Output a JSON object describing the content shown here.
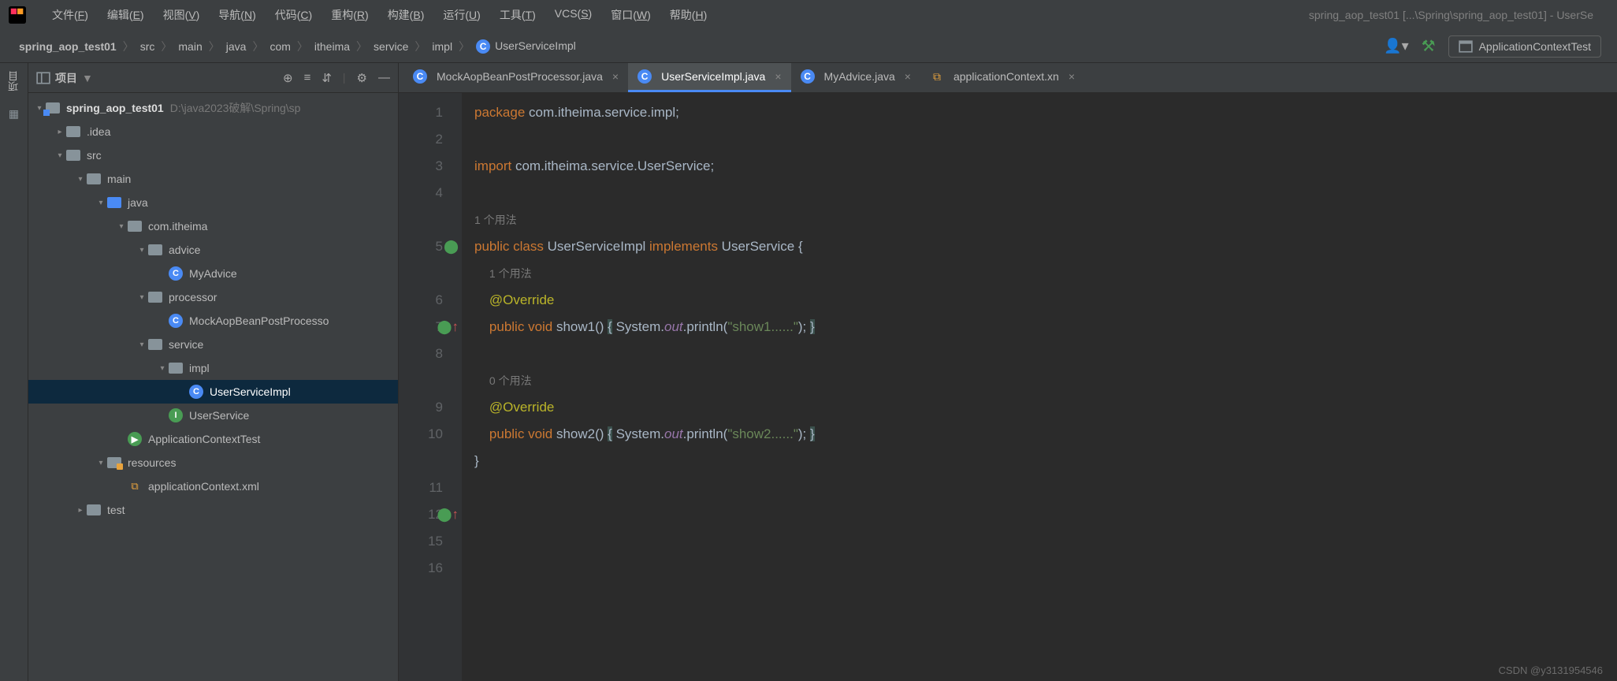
{
  "menubar": {
    "items": [
      {
        "text": "文件",
        "key": "F"
      },
      {
        "text": "编辑",
        "key": "E"
      },
      {
        "text": "视图",
        "key": "V"
      },
      {
        "text": "导航",
        "key": "N"
      },
      {
        "text": "代码",
        "key": "C"
      },
      {
        "text": "重构",
        "key": "R"
      },
      {
        "text": "构建",
        "key": "B"
      },
      {
        "text": "运行",
        "key": "U"
      },
      {
        "text": "工具",
        "key": "T"
      },
      {
        "text": "VCS",
        "key": "S"
      },
      {
        "text": "窗口",
        "key": "W"
      },
      {
        "text": "帮助",
        "key": "H"
      }
    ],
    "title_right": "spring_aop_test01 [...\\Spring\\spring_aop_test01] - UserSe"
  },
  "breadcrumb": {
    "parts": [
      "spring_aop_test01",
      "src",
      "main",
      "java",
      "com",
      "itheima",
      "service",
      "impl",
      "UserServiceImpl"
    ]
  },
  "run_config": "ApplicationContextTest",
  "project": {
    "header": "项目",
    "root": {
      "name": "spring_aop_test01",
      "path": "D:\\java2023破解\\Spring\\sp"
    },
    "tree_lines": [
      {
        "depth": 1,
        "arrow": "▸",
        "icon": "folder",
        "label": ".idea"
      },
      {
        "depth": 1,
        "arrow": "▾",
        "icon": "folder",
        "label": "src"
      },
      {
        "depth": 2,
        "arrow": "▾",
        "icon": "folder",
        "label": "main"
      },
      {
        "depth": 3,
        "arrow": "▾",
        "icon": "folder-blue",
        "label": "java"
      },
      {
        "depth": 4,
        "arrow": "▾",
        "icon": "folder",
        "label": "com.itheima"
      },
      {
        "depth": 5,
        "arrow": "▾",
        "icon": "folder",
        "label": "advice"
      },
      {
        "depth": 6,
        "arrow": "",
        "icon": "class",
        "label": "MyAdvice"
      },
      {
        "depth": 5,
        "arrow": "▾",
        "icon": "folder",
        "label": "processor"
      },
      {
        "depth": 6,
        "arrow": "",
        "icon": "class",
        "label": "MockAopBeanPostProcesso"
      },
      {
        "depth": 5,
        "arrow": "▾",
        "icon": "folder",
        "label": "service"
      },
      {
        "depth": 6,
        "arrow": "▾",
        "icon": "folder",
        "label": "impl"
      },
      {
        "depth": 7,
        "arrow": "",
        "icon": "class",
        "label": "UserServiceImpl",
        "selected": true
      },
      {
        "depth": 6,
        "arrow": "",
        "icon": "interface",
        "label": "UserService"
      },
      {
        "depth": 4,
        "arrow": "",
        "icon": "class-play",
        "label": "ApplicationContextTest"
      },
      {
        "depth": 3,
        "arrow": "▾",
        "icon": "folder-res",
        "label": "resources"
      },
      {
        "depth": 4,
        "arrow": "",
        "icon": "xml",
        "label": "applicationContext.xml"
      },
      {
        "depth": 2,
        "arrow": "▸",
        "icon": "folder",
        "label": "test"
      }
    ]
  },
  "left_tab": "项目",
  "editor": {
    "tabs": [
      {
        "icon": "class",
        "label": "MockAopBeanPostProcessor.java"
      },
      {
        "icon": "class",
        "label": "UserServiceImpl.java",
        "active": true
      },
      {
        "icon": "class",
        "label": "MyAdvice.java"
      },
      {
        "icon": "xml",
        "label": "applicationContext.xn"
      }
    ],
    "gutter": [
      "1",
      "2",
      "3",
      "4",
      "",
      "5",
      "",
      "6",
      "7",
      "8",
      "",
      "9",
      "10",
      "",
      "11",
      "12",
      "15",
      "16"
    ],
    "hints": {
      "one_usage": "1 个用法",
      "zero_usage": "0 个用法"
    },
    "code": {
      "package": "package",
      "pkg_path": "com.itheima.service.impl",
      "import": "import",
      "imp_path": "com.itheima.service.UserService",
      "public": "public",
      "class": "class",
      "cls_name": "UserServiceImpl",
      "implements": "implements",
      "iface": "UserService",
      "override": "@Override",
      "void": "void",
      "show1": "show1",
      "show2": "show2",
      "system": "System",
      "out": "out",
      "println": "println",
      "str1": "\"show1......\"",
      "str2": "\"show2......\""
    }
  },
  "watermark": "CSDN @y3131954546"
}
